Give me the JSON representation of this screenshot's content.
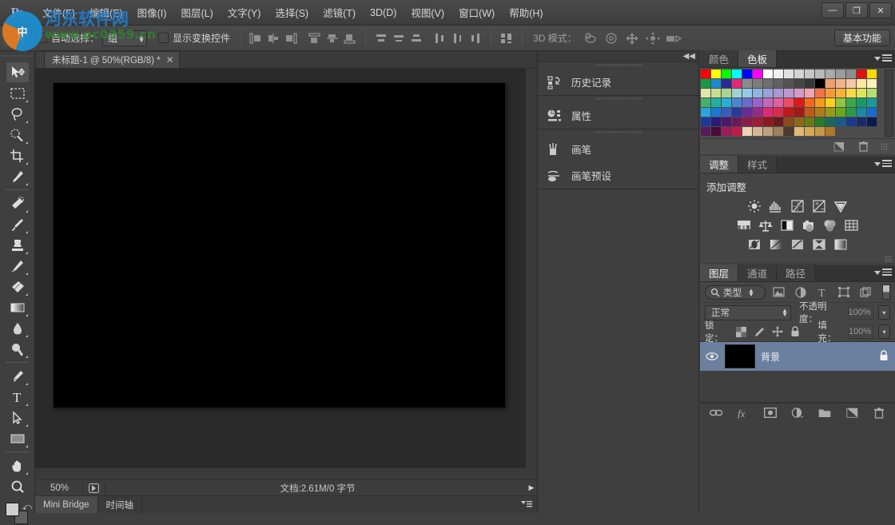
{
  "app": {
    "logo": "Ps"
  },
  "menubar": {
    "items": [
      {
        "label": "文件(F)"
      },
      {
        "label": "编辑(E)"
      },
      {
        "label": "图像(I)"
      },
      {
        "label": "图层(L)"
      },
      {
        "label": "文字(Y)"
      },
      {
        "label": "选择(S)"
      },
      {
        "label": "滤镜(T)"
      },
      {
        "label": "3D(D)"
      },
      {
        "label": "视图(V)"
      },
      {
        "label": "窗口(W)"
      },
      {
        "label": "帮助(H)"
      }
    ]
  },
  "window_controls": {
    "minimize": "—",
    "maximize": "❐",
    "close": "✕"
  },
  "watermark": {
    "line1": "河东软件网",
    "line2": "www.pc0359.cn"
  },
  "options_bar": {
    "auto_select_label": "自动选择：",
    "auto_select_value": "组",
    "show_transform_label": "显示变换控件",
    "mode3d_label": "3D 模式：",
    "workspace_button": "基本功能"
  },
  "toolbar": {
    "tools": [
      {
        "name": "move-tool",
        "selected": true
      },
      {
        "name": "marquee-tool",
        "selected": false
      },
      {
        "name": "lasso-tool",
        "selected": false
      },
      {
        "name": "quick-selection-tool",
        "selected": false
      },
      {
        "name": "crop-tool",
        "selected": false
      },
      {
        "name": "eyedropper-tool",
        "selected": false
      },
      {
        "name": "spot-healing-tool",
        "selected": false
      },
      {
        "name": "brush-tool",
        "selected": false
      },
      {
        "name": "clone-stamp-tool",
        "selected": false
      },
      {
        "name": "history-brush-tool",
        "selected": false
      },
      {
        "name": "eraser-tool",
        "selected": false
      },
      {
        "name": "gradient-tool",
        "selected": false
      },
      {
        "name": "blur-tool",
        "selected": false
      },
      {
        "name": "dodge-tool",
        "selected": false
      },
      {
        "name": "pen-tool",
        "selected": false
      },
      {
        "name": "type-tool",
        "selected": false
      },
      {
        "name": "path-selection-tool",
        "selected": false
      },
      {
        "name": "rectangle-tool",
        "selected": false
      },
      {
        "name": "hand-tool",
        "selected": false
      },
      {
        "name": "zoom-tool",
        "selected": false
      }
    ]
  },
  "document": {
    "tab_title": "未标题-1 @ 50%(RGB/8) *",
    "close_glyph": "✕",
    "canvas_color": "#000000"
  },
  "status_bar": {
    "zoom": "50%",
    "doc_info": "文档:2.61M/0 字节",
    "arrow": "▶"
  },
  "bottom_tabs": {
    "items": [
      {
        "label": "Mini Bridge",
        "active": true
      },
      {
        "label": "时间轴",
        "active": false
      }
    ]
  },
  "middle_dock": {
    "collapse_icon": "◀◀",
    "groups": [
      {
        "rows": [
          {
            "label": "历史记录",
            "icon": "history-icon"
          }
        ]
      },
      {
        "rows": [
          {
            "label": "属性",
            "icon": "properties-icon"
          }
        ]
      },
      {
        "rows": [
          {
            "label": "画笔",
            "icon": "brush-icon"
          },
          {
            "label": "画笔预设",
            "icon": "brush-presets-icon"
          }
        ]
      }
    ]
  },
  "color_panel": {
    "tabs": [
      {
        "label": "颜色",
        "active": false
      },
      {
        "label": "色板",
        "active": true
      }
    ],
    "swatches": [
      "#ff0000",
      "#ffff00",
      "#00ff00",
      "#00ffff",
      "#0000ff",
      "#ff00ff",
      "#ffffff",
      "#f0f0f0",
      "#e2e2e2",
      "#d4d4d4",
      "#c6c6c6",
      "#b8b8b8",
      "#aaaaaa",
      "#9c9c9c",
      "#8e8e8e",
      "#e01010",
      "#ffd800",
      "#1a9a44",
      "#1a8ad0",
      "#2a2a96",
      "#e52876",
      "#8b8b8b",
      "#7d7d7d",
      "#6f6f6f",
      "#616161",
      "#535353",
      "#454545",
      "#373737",
      "#000000",
      "#f0a070",
      "#f2b48c",
      "#f5c9a8",
      "#fbe7a0",
      "#fbf2bb",
      "#dfe7a8",
      "#c8dc92",
      "#a9d58f",
      "#9fd3cd",
      "#94cbe8",
      "#8fb4e0",
      "#9aa2d8",
      "#a998d2",
      "#bf98cf",
      "#d29ac5",
      "#f0a4b0",
      "#f2724a",
      "#f79b3a",
      "#f7b23a",
      "#fbd84a",
      "#dbe55c",
      "#b4de74",
      "#43b06a",
      "#1fb0a0",
      "#26b0d8",
      "#4a86d0",
      "#6a6ad0",
      "#9a62c8",
      "#c466bb",
      "#e05fa0",
      "#ef4a5f",
      "#e01818",
      "#f06a1a",
      "#f79a1a",
      "#fbd01a",
      "#8ec63f",
      "#3aa84a",
      "#1a9a6a",
      "#1a9a9a",
      "#2aa4e0",
      "#1a7ad0",
      "#3a5ec0",
      "#2a3a9a",
      "#6a2a96",
      "#962a8a",
      "#e02a78",
      "#e02a4a",
      "#c01818",
      "#a01818",
      "#c05a1a",
      "#b07a1a",
      "#9a9a1a",
      "#6aaa1a",
      "#2a9a4a",
      "#1a8aa0",
      "#1a6ad0",
      "#1a3a9a",
      "#2a1a7a",
      "#4a1a6a",
      "#6a1a5a",
      "#8a1a4a",
      "#a01a3a",
      "#8a1a1a",
      "#6a1a1a",
      "#8a4a1a",
      "#8a6a1a",
      "#6a7a1a",
      "#2a7a2a",
      "#1a6a5a",
      "#1a5a8a",
      "#1a3a8a",
      "#1a2a6a",
      "#0a1a4a",
      "#5a1a5a",
      "#4a0a3a",
      "#a01a5a",
      "#c01a4a",
      "#e8d4b0",
      "#d8b894",
      "#c0a080",
      "#a08060",
      "#4a3a2a",
      "#e0b878",
      "#d8a858",
      "#c89848",
      "#b07828",
      "#4c4c4c",
      "#4c4c4c",
      "#4c4c4c",
      "#4c4c4c"
    ]
  },
  "adjustments_panel": {
    "tabs": [
      {
        "label": "调整",
        "active": true
      },
      {
        "label": "样式",
        "active": false
      }
    ],
    "title": "添加调整",
    "buttons": [
      {
        "name": "brightness-contrast-adjustment"
      },
      {
        "name": "levels-adjustment"
      },
      {
        "name": "curves-adjustment"
      },
      {
        "name": "exposure-adjustment"
      },
      {
        "name": "vibrance-adjustment"
      },
      {
        "name": "hue-saturation-adjustment"
      },
      {
        "name": "color-balance-adjustment"
      },
      {
        "name": "black-white-adjustment"
      },
      {
        "name": "photo-filter-adjustment"
      },
      {
        "name": "channel-mixer-adjustment"
      },
      {
        "name": "color-lookup-adjustment"
      },
      {
        "name": "invert-adjustment"
      },
      {
        "name": "posterize-adjustment"
      },
      {
        "name": "threshold-adjustment"
      },
      {
        "name": "selective-color-adjustment"
      },
      {
        "name": "gradient-map-adjustment"
      }
    ]
  },
  "layers_panel": {
    "tabs": [
      {
        "label": "图层",
        "active": true
      },
      {
        "label": "通道",
        "active": false
      },
      {
        "label": "路径",
        "active": false
      }
    ],
    "filter_value": "类型",
    "blend_mode": "正常",
    "opacity_label": "不透明度：",
    "opacity_value": "100%",
    "lock_label": "锁定：",
    "fill_label": "填充：",
    "fill_value": "100%",
    "layers": [
      {
        "name": "背景",
        "locked": true,
        "visible": true,
        "thumb_color": "#000000"
      }
    ]
  }
}
